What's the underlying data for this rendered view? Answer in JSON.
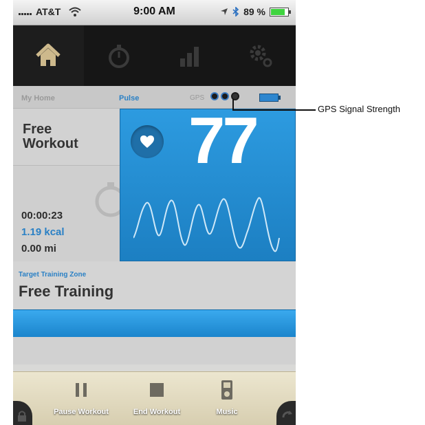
{
  "status_bar": {
    "carrier": "AT&T",
    "time": "9:00 AM",
    "battery": "89 %",
    "battery_fraction": 0.89
  },
  "nav": {
    "items": [
      {
        "icon": "home-icon",
        "active": true
      },
      {
        "icon": "stopwatch-icon",
        "active": false
      },
      {
        "icon": "bar-chart-icon",
        "active": false
      },
      {
        "icon": "gears-icon",
        "active": false
      }
    ]
  },
  "tabs": {
    "home": "My Home",
    "pulse": "Pulse",
    "gps_label": "GPS"
  },
  "workout": {
    "title": "Free\nWorkout",
    "elapsed": "00:00:23",
    "calories": "1.19 kcal",
    "distance": "0.00 mi"
  },
  "pulse": {
    "bpm": "77"
  },
  "zone": {
    "label": "Target Training Zone",
    "value": "Free Training"
  },
  "toolbar": {
    "pause": "Pause Workout",
    "end": "End Workout",
    "music": "Music"
  },
  "annotation": {
    "gps": "GPS Signal Strength"
  },
  "colors": {
    "accent_blue": "#2a80c5",
    "pulse_blue": "#1c7fc2",
    "nav_black": "#161616"
  }
}
